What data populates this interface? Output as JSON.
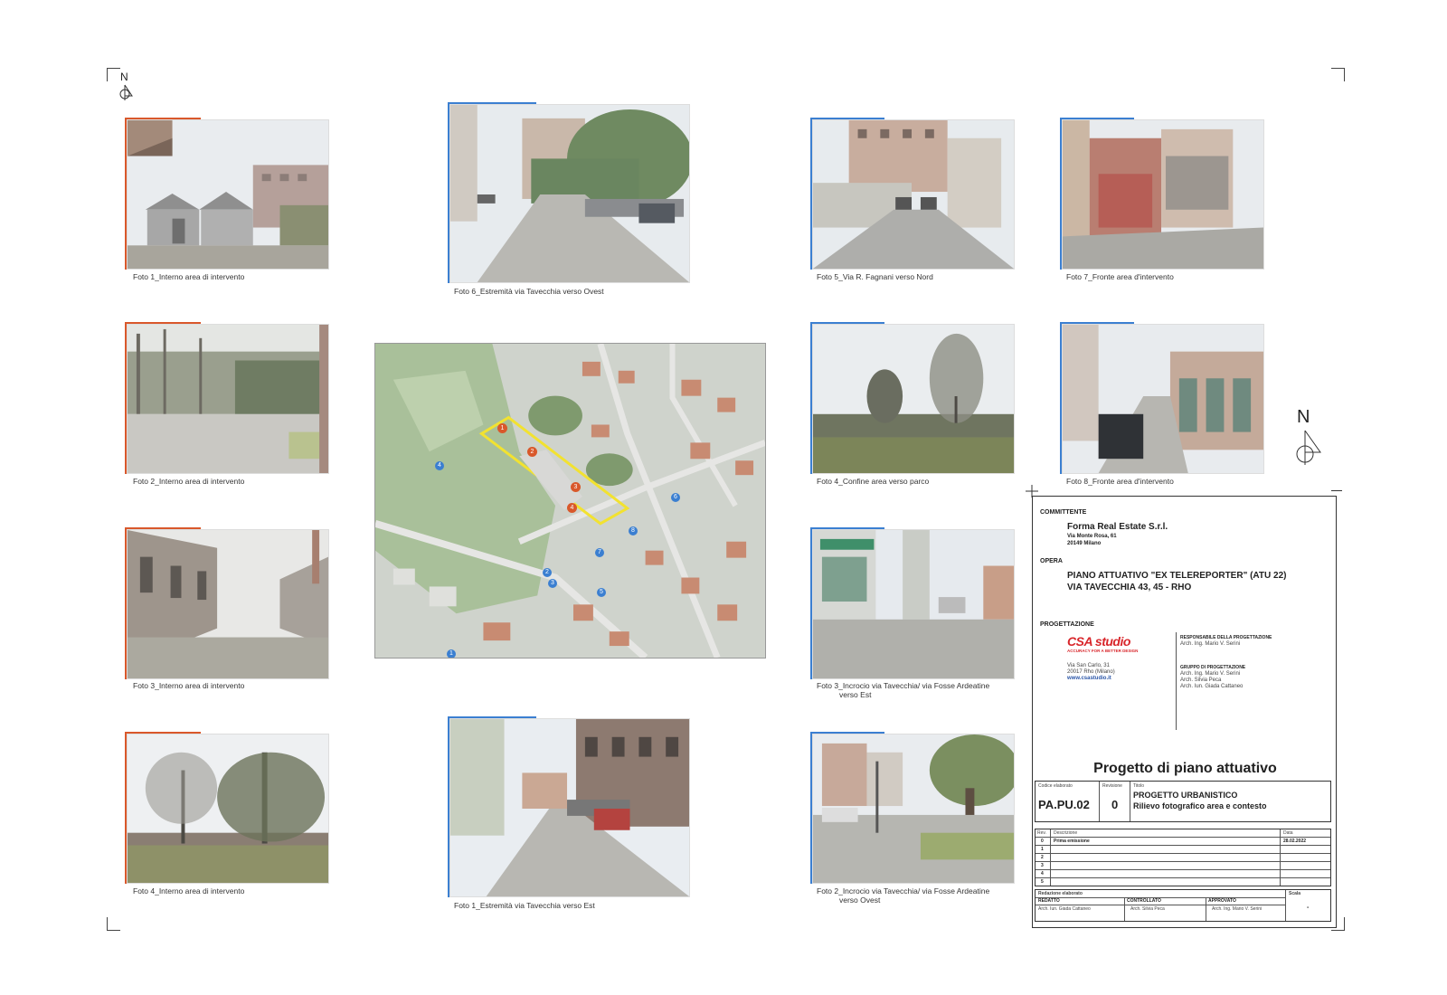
{
  "north_label": "N",
  "photos": {
    "int1": "Foto 1_Interno area di intervento",
    "int2": "Foto 2_Interno area di intervento",
    "int3": "Foto 3_Interno area di intervento",
    "int4": "Foto 4_Interno area di intervento",
    "ctx6": "Foto 6_Estremità via Tavecchia verso Ovest",
    "ctx1": "Foto 1_Estremità via Tavecchia verso Est",
    "ctx5": "Foto 5_Via R. Fagnani verso Nord",
    "ctx4": "Foto 4_Confine area verso parco",
    "ctx3a": "Foto 3_Incrocio via Tavecchia/ via Fosse Ardeatine",
    "ctx3b": "verso Est",
    "ctx2a": "Foto 2_Incrocio via Tavecchia/ via Fosse Ardeatine",
    "ctx2b": "verso Ovest",
    "ctx7": "Foto 7_Fronte area d'intervento",
    "ctx8": "Foto 8_Fronte area d'intervento"
  },
  "map_markers": {
    "orange": [
      "1",
      "2",
      "3",
      "4"
    ],
    "blue": [
      "1",
      "2",
      "3",
      "4",
      "5",
      "6",
      "7",
      "8"
    ]
  },
  "title_block": {
    "committente_label": "COMMITTENTE",
    "committente_name": "Forma Real Estate S.r.l.",
    "committente_addr1": "Via Monte Rosa, 61",
    "committente_addr2": "20149 Milano",
    "opera_label": "OPERA",
    "opera_line1": "PIANO ATTUATIVO \"EX TELEREPORTER\" (ATU 22)",
    "opera_line2": "VIA TAVECCHIA 43, 45 - RHO",
    "progettazione_label": "PROGETTAZIONE",
    "logo_text": "CSA studio",
    "logo_tagline": "ACCURACY FOR A BETTER DESIGN",
    "studio_addr1": "Via San Carlo, 31",
    "studio_addr2": "20017 Rho (Milano)",
    "studio_web": "www.csastudio.it",
    "resp_label": "RESPONSABILE DELLA PROGETTAZIONE",
    "resp_name": "Arch. Ing. Mario V. Serini",
    "gruppo_label": "GRUPPO DI PROGETTAZIONE",
    "gruppo_1": "Arch. Ing. Mario V. Serini",
    "gruppo_2": "Arch. Silvia Peca",
    "gruppo_3": "Arch. Iun. Giada Cattaneo",
    "main_title": "Progetto di piano attuativo",
    "codice_label": "Codice elaborato",
    "codice_value": "PA.PU.02",
    "revisione_label": "Revisione",
    "revisione_value": "0",
    "titolo_label": "Titolo",
    "titolo_line1": "PROGETTO URBANISTICO",
    "titolo_line2": "Rilievo fotografico area e contesto",
    "rev_label": "Rev.",
    "descr_label": "Descrizione",
    "data_label": "Data",
    "rev_rows": [
      "0",
      "1",
      "2",
      "3",
      "4",
      "5"
    ],
    "rev0_desc": "Prima emissione",
    "rev0_date": "28.02.2022",
    "redazione_label": "Redazione elaborato",
    "scala_label": "Scala",
    "redatto_label": "REDATTO",
    "controllato_label": "CONTROLLATO",
    "approvato_label": "APPROVATO",
    "redatto_name": "Arch. Iun. Giada Cattaneo",
    "controllato_name": "Arch. Silvia Peca",
    "approvato_name": "Arch. Ing. Mario V. Serini",
    "scala_value": "-"
  },
  "colors": {
    "orange": "#d9582b",
    "blue": "#3b7fd1",
    "yellow": "#f2e230"
  }
}
